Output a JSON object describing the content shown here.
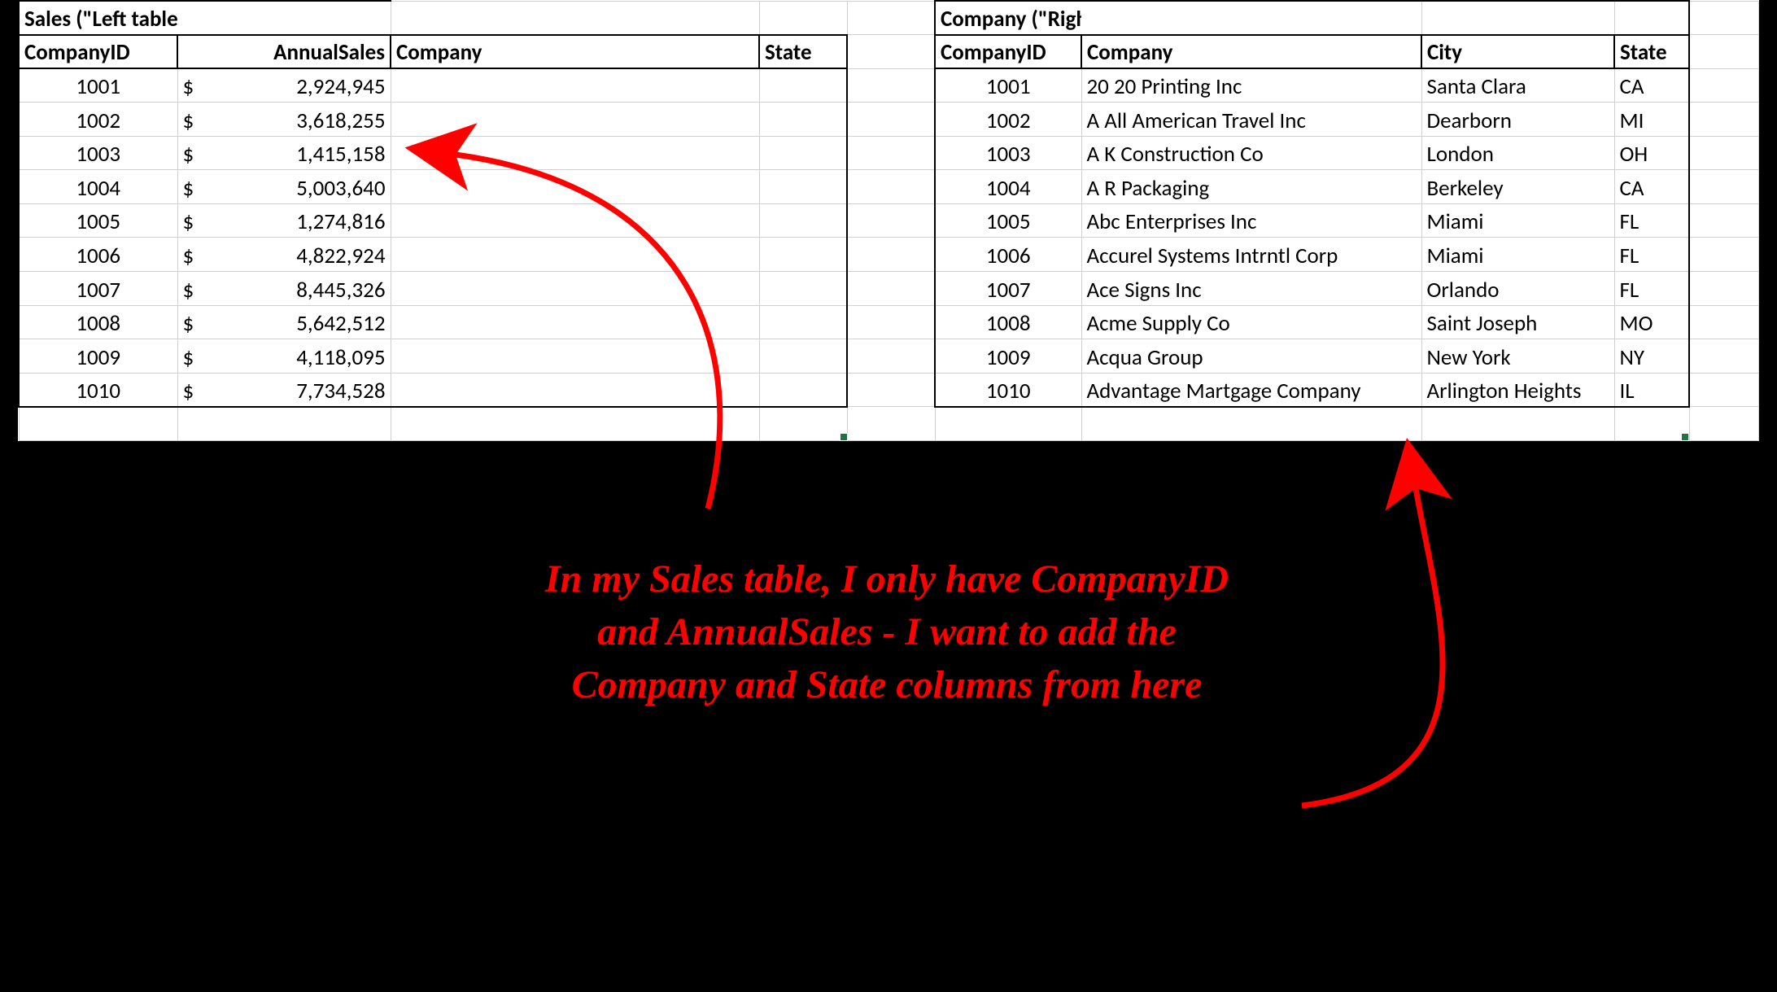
{
  "sales": {
    "title": "Sales (\"Left table\")",
    "headers": {
      "id": "CompanyID",
      "sales": "AnnualSales",
      "company": "Company",
      "state": "State"
    },
    "rows": [
      {
        "id": "1001",
        "sales": "2,924,945"
      },
      {
        "id": "1002",
        "sales": "3,618,255"
      },
      {
        "id": "1003",
        "sales": "1,415,158"
      },
      {
        "id": "1004",
        "sales": "5,003,640"
      },
      {
        "id": "1005",
        "sales": "1,274,816"
      },
      {
        "id": "1006",
        "sales": "4,822,924"
      },
      {
        "id": "1007",
        "sales": "8,445,326"
      },
      {
        "id": "1008",
        "sales": "5,642,512"
      },
      {
        "id": "1009",
        "sales": "4,118,095"
      },
      {
        "id": "1010",
        "sales": "7,734,528"
      }
    ]
  },
  "company": {
    "title": "Company (\"Right table\")",
    "headers": {
      "id": "CompanyID",
      "company": "Company",
      "city": "City",
      "state": "State"
    },
    "rows": [
      {
        "id": "1001",
        "company": "20 20 Printing Inc",
        "city": "Santa Clara",
        "state": "CA"
      },
      {
        "id": "1002",
        "company": "A All American Travel Inc",
        "city": "Dearborn",
        "state": "MI"
      },
      {
        "id": "1003",
        "company": "A K Construction Co",
        "city": "London",
        "state": "OH"
      },
      {
        "id": "1004",
        "company": "A R Packaging",
        "city": "Berkeley",
        "state": "CA"
      },
      {
        "id": "1005",
        "company": "Abc Enterprises Inc",
        "city": "Miami",
        "state": "FL"
      },
      {
        "id": "1006",
        "company": "Accurel Systems Intrntl Corp",
        "city": "Miami",
        "state": "FL"
      },
      {
        "id": "1007",
        "company": "Ace Signs Inc",
        "city": "Orlando",
        "state": "FL"
      },
      {
        "id": "1008",
        "company": "Acme Supply Co",
        "city": "Saint Joseph",
        "state": "MO"
      },
      {
        "id": "1009",
        "company": "Acqua Group",
        "city": "New York",
        "state": "NY"
      },
      {
        "id": "1010",
        "company": "Advantage Martgage Company",
        "city": "Arlington Heights",
        "state": "IL"
      }
    ]
  },
  "currency_symbol": "$",
  "annotation": "In my Sales table, I only have CompanyID and AnnualSales - I want to add the Company and State columns from here"
}
